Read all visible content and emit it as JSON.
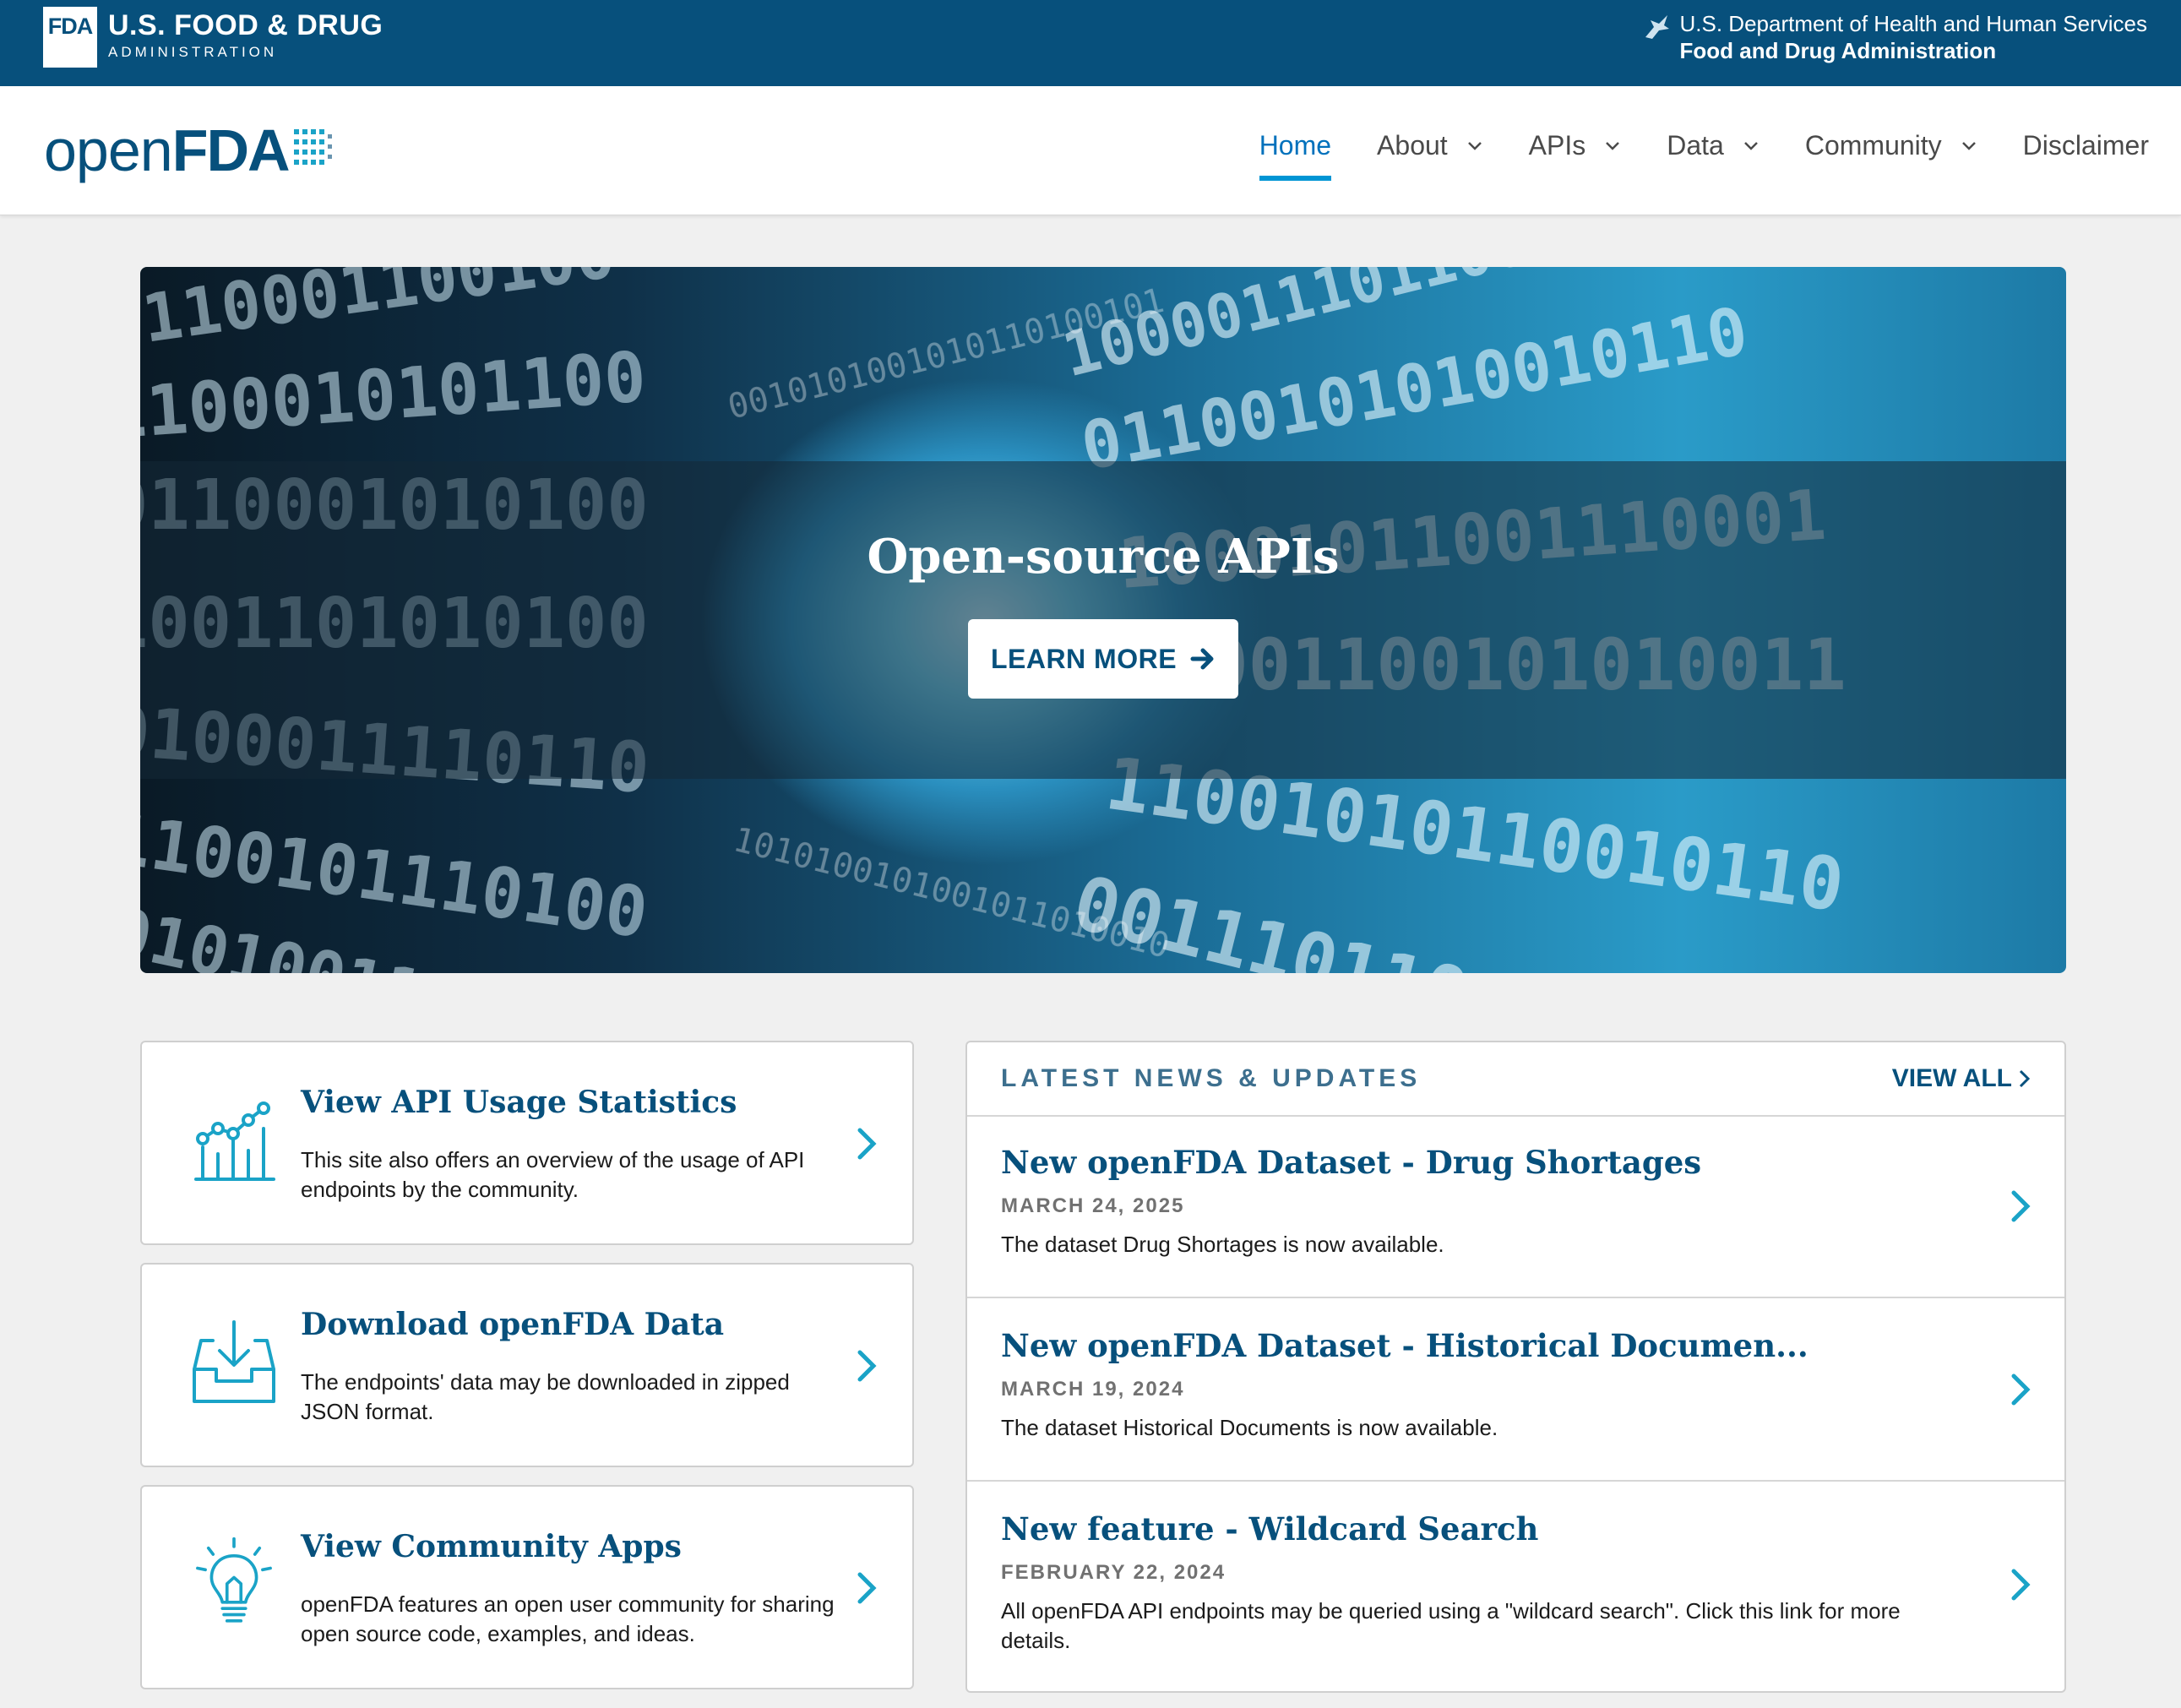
{
  "agency": {
    "badge": "FDA",
    "name_line1": "U.S. FOOD & DRUG",
    "name_line2": "ADMINISTRATION",
    "dept_line1": "U.S. Department of Health and Human Services",
    "dept_line2": "Food and Drug Administration"
  },
  "logo": {
    "open": "open",
    "fda": "FDA"
  },
  "nav": [
    {
      "label": "Home",
      "active": true,
      "dropdown": false
    },
    {
      "label": "About",
      "active": false,
      "dropdown": true
    },
    {
      "label": "APIs",
      "active": false,
      "dropdown": true
    },
    {
      "label": "Data",
      "active": false,
      "dropdown": true
    },
    {
      "label": "Community",
      "active": false,
      "dropdown": true
    },
    {
      "label": "Disclaimer",
      "active": false,
      "dropdown": false
    }
  ],
  "hero": {
    "title": "Open-source APIs",
    "button": "LEARN MORE"
  },
  "cards": [
    {
      "title": "View API Usage Statistics",
      "desc": "This site also offers an overview of the usage of API endpoints by the community.",
      "icon": "chart-icon"
    },
    {
      "title": "Download openFDA Data",
      "desc": "The endpoints' data may be downloaded in zipped JSON format.",
      "icon": "download-tray-icon"
    },
    {
      "title": "View Community Apps",
      "desc": "openFDA features an open user community for sharing open source code, examples, and ideas.",
      "icon": "lightbulb-icon"
    }
  ],
  "news": {
    "heading": "LATEST NEWS & UPDATES",
    "view_all": "VIEW ALL",
    "items": [
      {
        "title": "New openFDA Dataset - Drug Shortages",
        "date": "MARCH 24, 2025",
        "summary": "The dataset Drug Shortages is now available."
      },
      {
        "title": "New openFDA Dataset - Historical Documen...",
        "date": "MARCH 19, 2024",
        "summary": "The dataset Historical Documents is now available."
      },
      {
        "title": "New feature - Wildcard Search",
        "date": "FEBRUARY 22, 2024",
        "summary": "All openFDA API endpoints may be queried using a \"wildcard search\". Click this link for more details."
      }
    ]
  },
  "colors": {
    "brand": "#07507c",
    "accent": "#0095d4",
    "icon": "#1aa3c7"
  }
}
